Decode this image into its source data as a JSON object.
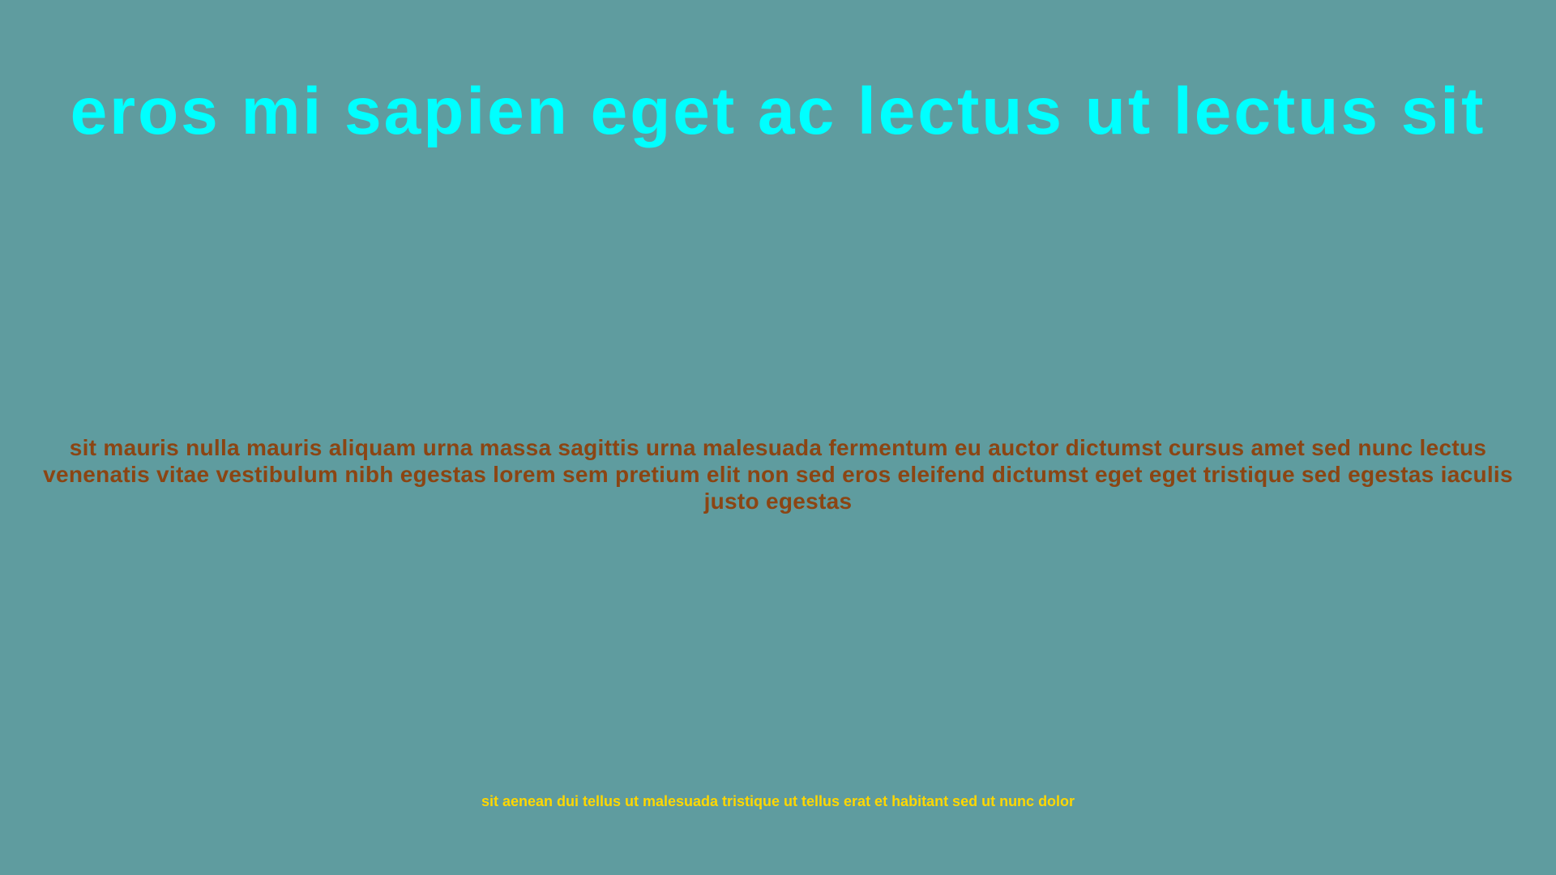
{
  "colors": {
    "background": "#5f9c9f",
    "title": "#00ffff",
    "body": "#8b4513",
    "footer": "#ffd700"
  },
  "title": "eros mi sapien eget ac lectus ut lectus sit",
  "body": "sit mauris nulla mauris aliquam urna massa sagittis urna malesuada fermentum eu auctor dictumst cursus amet sed nunc lectus venenatis vitae vestibulum nibh egestas lorem sem pretium elit non sed eros eleifend dictumst eget eget tristique sed egestas iaculis justo egestas",
  "footer": "sit aenean dui tellus ut malesuada tristique ut tellus erat et habitant sed ut nunc dolor"
}
